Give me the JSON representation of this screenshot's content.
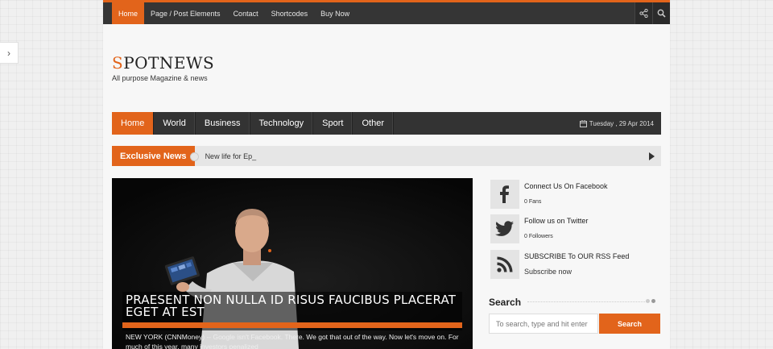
{
  "top_nav": {
    "items": [
      {
        "label": "Home",
        "active": true
      },
      {
        "label": "Page / Post Elements",
        "active": false
      },
      {
        "label": "Contact",
        "active": false
      },
      {
        "label": "Shortcodes",
        "active": false
      },
      {
        "label": "Buy Now",
        "active": false
      }
    ],
    "icons": [
      "share-icon",
      "search-icon"
    ]
  },
  "logo": {
    "first_letter": "S",
    "rest": "POTNEWS",
    "tagline": "All purpose Magazine & news"
  },
  "main_nav": {
    "items": [
      {
        "label": "Home",
        "active": true
      },
      {
        "label": "World",
        "active": false
      },
      {
        "label": "Business",
        "active": false
      },
      {
        "label": "Technology",
        "active": false
      },
      {
        "label": "Sport",
        "active": false
      },
      {
        "label": "Other",
        "active": false
      }
    ],
    "date": "Tuesday , 29 Apr 2014"
  },
  "ticker": {
    "label": "Exclusive News",
    "text": "New life for Ep_"
  },
  "featured": {
    "headline": "PRAESENT NON NULLA ID RISUS FAUCIBUS PLACERAT EGET AT EST",
    "excerpt": "NEW YORK (CNNMoney) -- Google isn't Facebook. There. We got that out of the way. Now let's move on. For much of this year, many investors penalized"
  },
  "social": [
    {
      "title": "Connect Us On Facebook",
      "count": "0 Fans",
      "icon": "facebook-icon"
    },
    {
      "title": "Follow us on Twitter",
      "count": "0 Followers",
      "icon": "twitter-icon"
    },
    {
      "title": "SUBSCRIBE To OUR RSS Feed",
      "count": "Subscribe now",
      "icon": "rss-icon"
    }
  ],
  "search": {
    "title": "Search",
    "placeholder": "To search, type and hit enter",
    "button": "Search"
  },
  "colors": {
    "accent": "#e2641b",
    "nav_bg": "#333333"
  }
}
